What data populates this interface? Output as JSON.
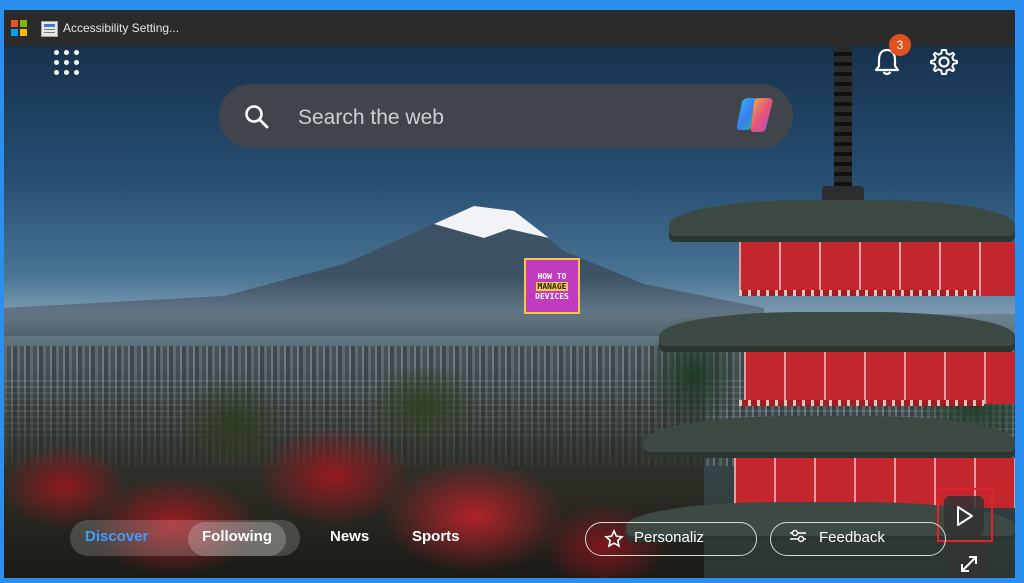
{
  "window": {
    "tab_title": "Accessibility Setting...",
    "ms_logo_colors": [
      "#f25022",
      "#7fba00",
      "#00a4ef",
      "#ffb900"
    ]
  },
  "header": {
    "apps_icon": "apps-grid-icon",
    "notifications": {
      "icon": "bell-icon",
      "count": "3"
    },
    "settings_icon": "gear-icon"
  },
  "search": {
    "placeholder": "Search the web",
    "search_icon": "search-icon",
    "copilot_icon": "copilot-icon"
  },
  "watermark": {
    "line1": "HOW TO",
    "line2": "MANAGE",
    "line3": "DEVICES"
  },
  "media_controls": {
    "play_icon": "play-icon",
    "expand_icon": "expand-icon"
  },
  "feed_bar": {
    "tabs": [
      {
        "label": "Discover",
        "active": true
      },
      {
        "label": "Following"
      },
      {
        "label": "News"
      },
      {
        "label": "Sports"
      }
    ],
    "personalize_label": "Personaliz",
    "feedback_label": "Feedback"
  },
  "colors": {
    "accent_blue": "#2b8ff0",
    "badge": "#e0531f",
    "highlight_box": "#e0222a",
    "pagoda_red": "#c3262d"
  }
}
